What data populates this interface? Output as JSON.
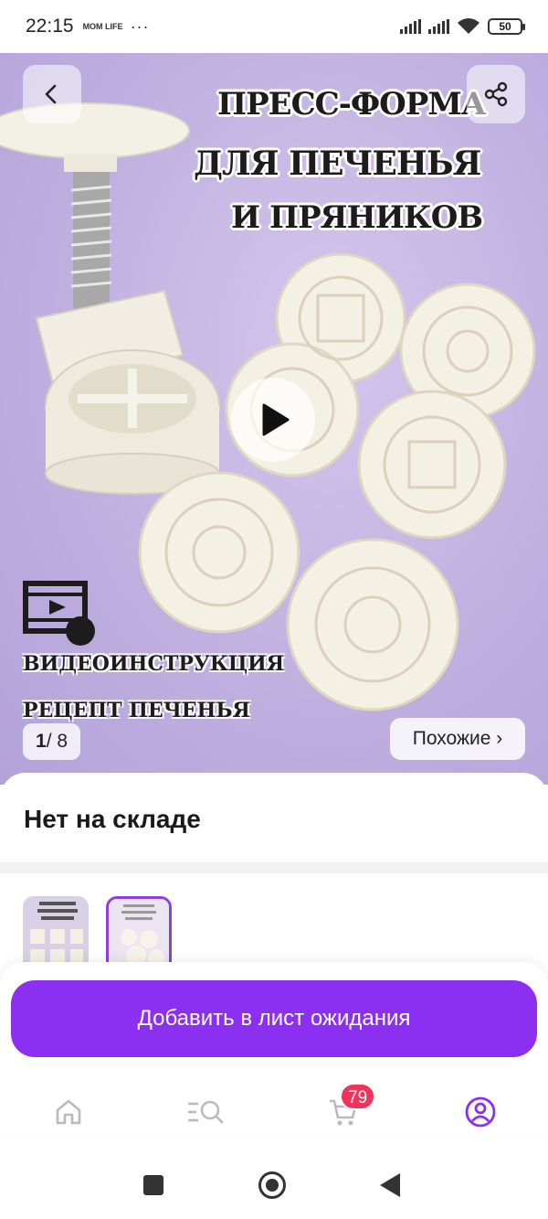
{
  "status_bar": {
    "time": "22:15",
    "app_badge": "MOM LIFE",
    "more": "···",
    "battery": "50"
  },
  "gallery": {
    "image_title_lines": [
      "ПРЕСС-ФОРМА",
      "ДЛЯ ПЕЧЕНЬЯ",
      "И ПРЯНИКОВ"
    ],
    "image_caption_lines": [
      "ВИДЕОИНСТРУКЦИЯ",
      "РЕЦЕПТ ПЕЧЕНЬЯ"
    ],
    "counter_current": "1",
    "counter_total": "/ 8",
    "similar_label": "Похожие ›",
    "back_icon": "chevron-left-icon",
    "share_icon": "share-icon",
    "play_icon": "play-icon"
  },
  "product": {
    "stock_status": "Нет на складе"
  },
  "thumbnails": {
    "count_shown": 2,
    "selected_index": 1
  },
  "actions": {
    "waitlist_label": "Добавить в лист ожидания"
  },
  "tabbar": {
    "items": [
      "home-icon",
      "catalog-search-icon",
      "cart-icon",
      "profile-icon"
    ],
    "cart_badge": "79",
    "active_color": "#8b2ff0",
    "inactive_color": "#b9b9c2"
  },
  "colors": {
    "accent": "#8b2ff0",
    "badge": "#f0335a"
  }
}
